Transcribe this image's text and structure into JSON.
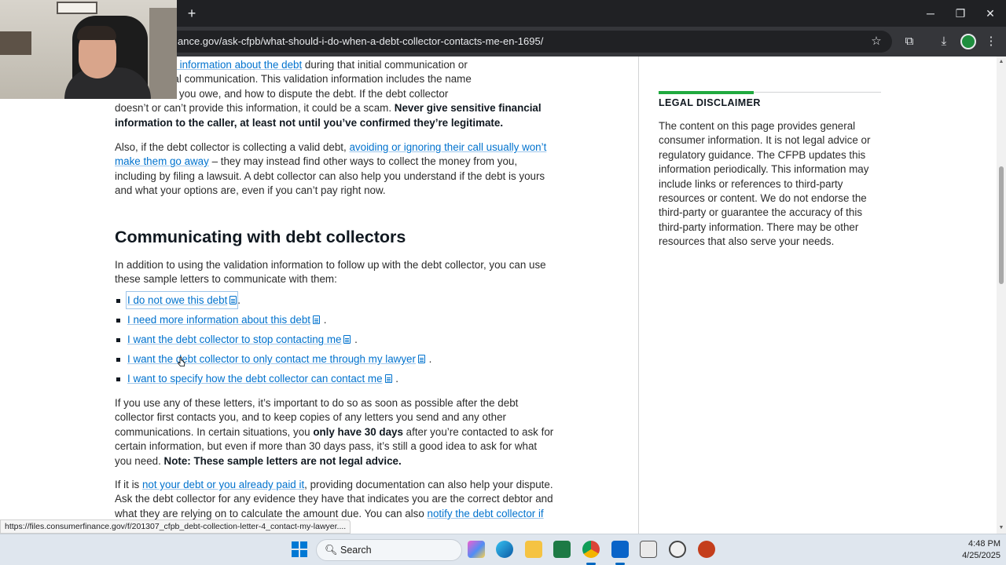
{
  "browser": {
    "url": "ance.gov/ask-cfpb/what-should-i-do-when-a-debt-collector-contacts-me-en-1695/",
    "new_tab_label": "+",
    "status_url": "https://files.consumerfinance.gov/f/201307_cfpb_debt-collection-letter-4_contact-my-lawyer...."
  },
  "article": {
    "p1_link": "u with certain information about the debt",
    "p1_a": " during that initial communication or",
    "p1_b": "ys of the initial communication. This validation information includes the name",
    "p1_c": "r, the amount you owe, and how to dispute the debt. If the debt collector",
    "p1_d": "doesn’t or can’t provide this information, it could be a scam. ",
    "p1_bold": "Never give sensitive financial information to the caller, at least not until you’ve confirmed they’re legitimate.",
    "p2_a": "Also, if the debt collector is collecting a valid debt, ",
    "p2_link": "avoiding or ignoring their call usually won’t make them go away",
    "p2_b": " – they may instead find other ways to collect the money from you, including by filing a lawsuit. A debt collector can also help you understand if the debt is yours and what your options are, even if you can’t pay right now.",
    "heading": "Communicating with debt collectors",
    "p3": "In addition to using the validation information to follow up with the debt collector, you can use these sample letters to communicate with them:",
    "letters": [
      "I do not owe this debt",
      "I need more information about this debt",
      "I want the debt collector to stop contacting me",
      "I want the debt collector to only contact me through my lawyer",
      "I want to specify how the debt collector can contact me"
    ],
    "period": ".",
    "p4_a": "If you use any of these letters, it’s important to do so as soon as possible after the debt collector first contacts you, and to keep copies of any letters you send and any other communications. In certain situations, you ",
    "p4_bold1": "only have 30 days",
    "p4_b": " after you’re contacted to ask for certain information, but even if more than 30 days pass, it’s still a good idea to ask for what you need. ",
    "p4_bold2": "Note: These sample letters are not legal advice.",
    "p5_a": "If it is ",
    "p5_link1": "not your debt or you already paid it",
    "p5_b": ", providing documentation can also help your dispute. Ask the debt collector for any evidence they have that indicates you are the correct debtor and what they are relying on to calculate the amount due. You can also ",
    "p5_link2": "notify the debt collector if you want them to stop communicating with you."
  },
  "sidebar": {
    "title": "LEGAL DISCLAIMER",
    "text": "The content on this page provides general consumer information. It is not legal advice or regulatory guidance. The CFPB updates this information periodically. This information may include links or references to third-party resources or content. We do not endorse the third-party or guarantee the accuracy of this third-party information. There may be other resources that also serve your needs."
  },
  "taskbar": {
    "search_label": "Search",
    "time": "4:48 PM",
    "date": "4/25/2025"
  },
  "colors": {
    "link": "#0072ce",
    "accent_green": "#20aa3f",
    "text": "#2b2b2b"
  }
}
